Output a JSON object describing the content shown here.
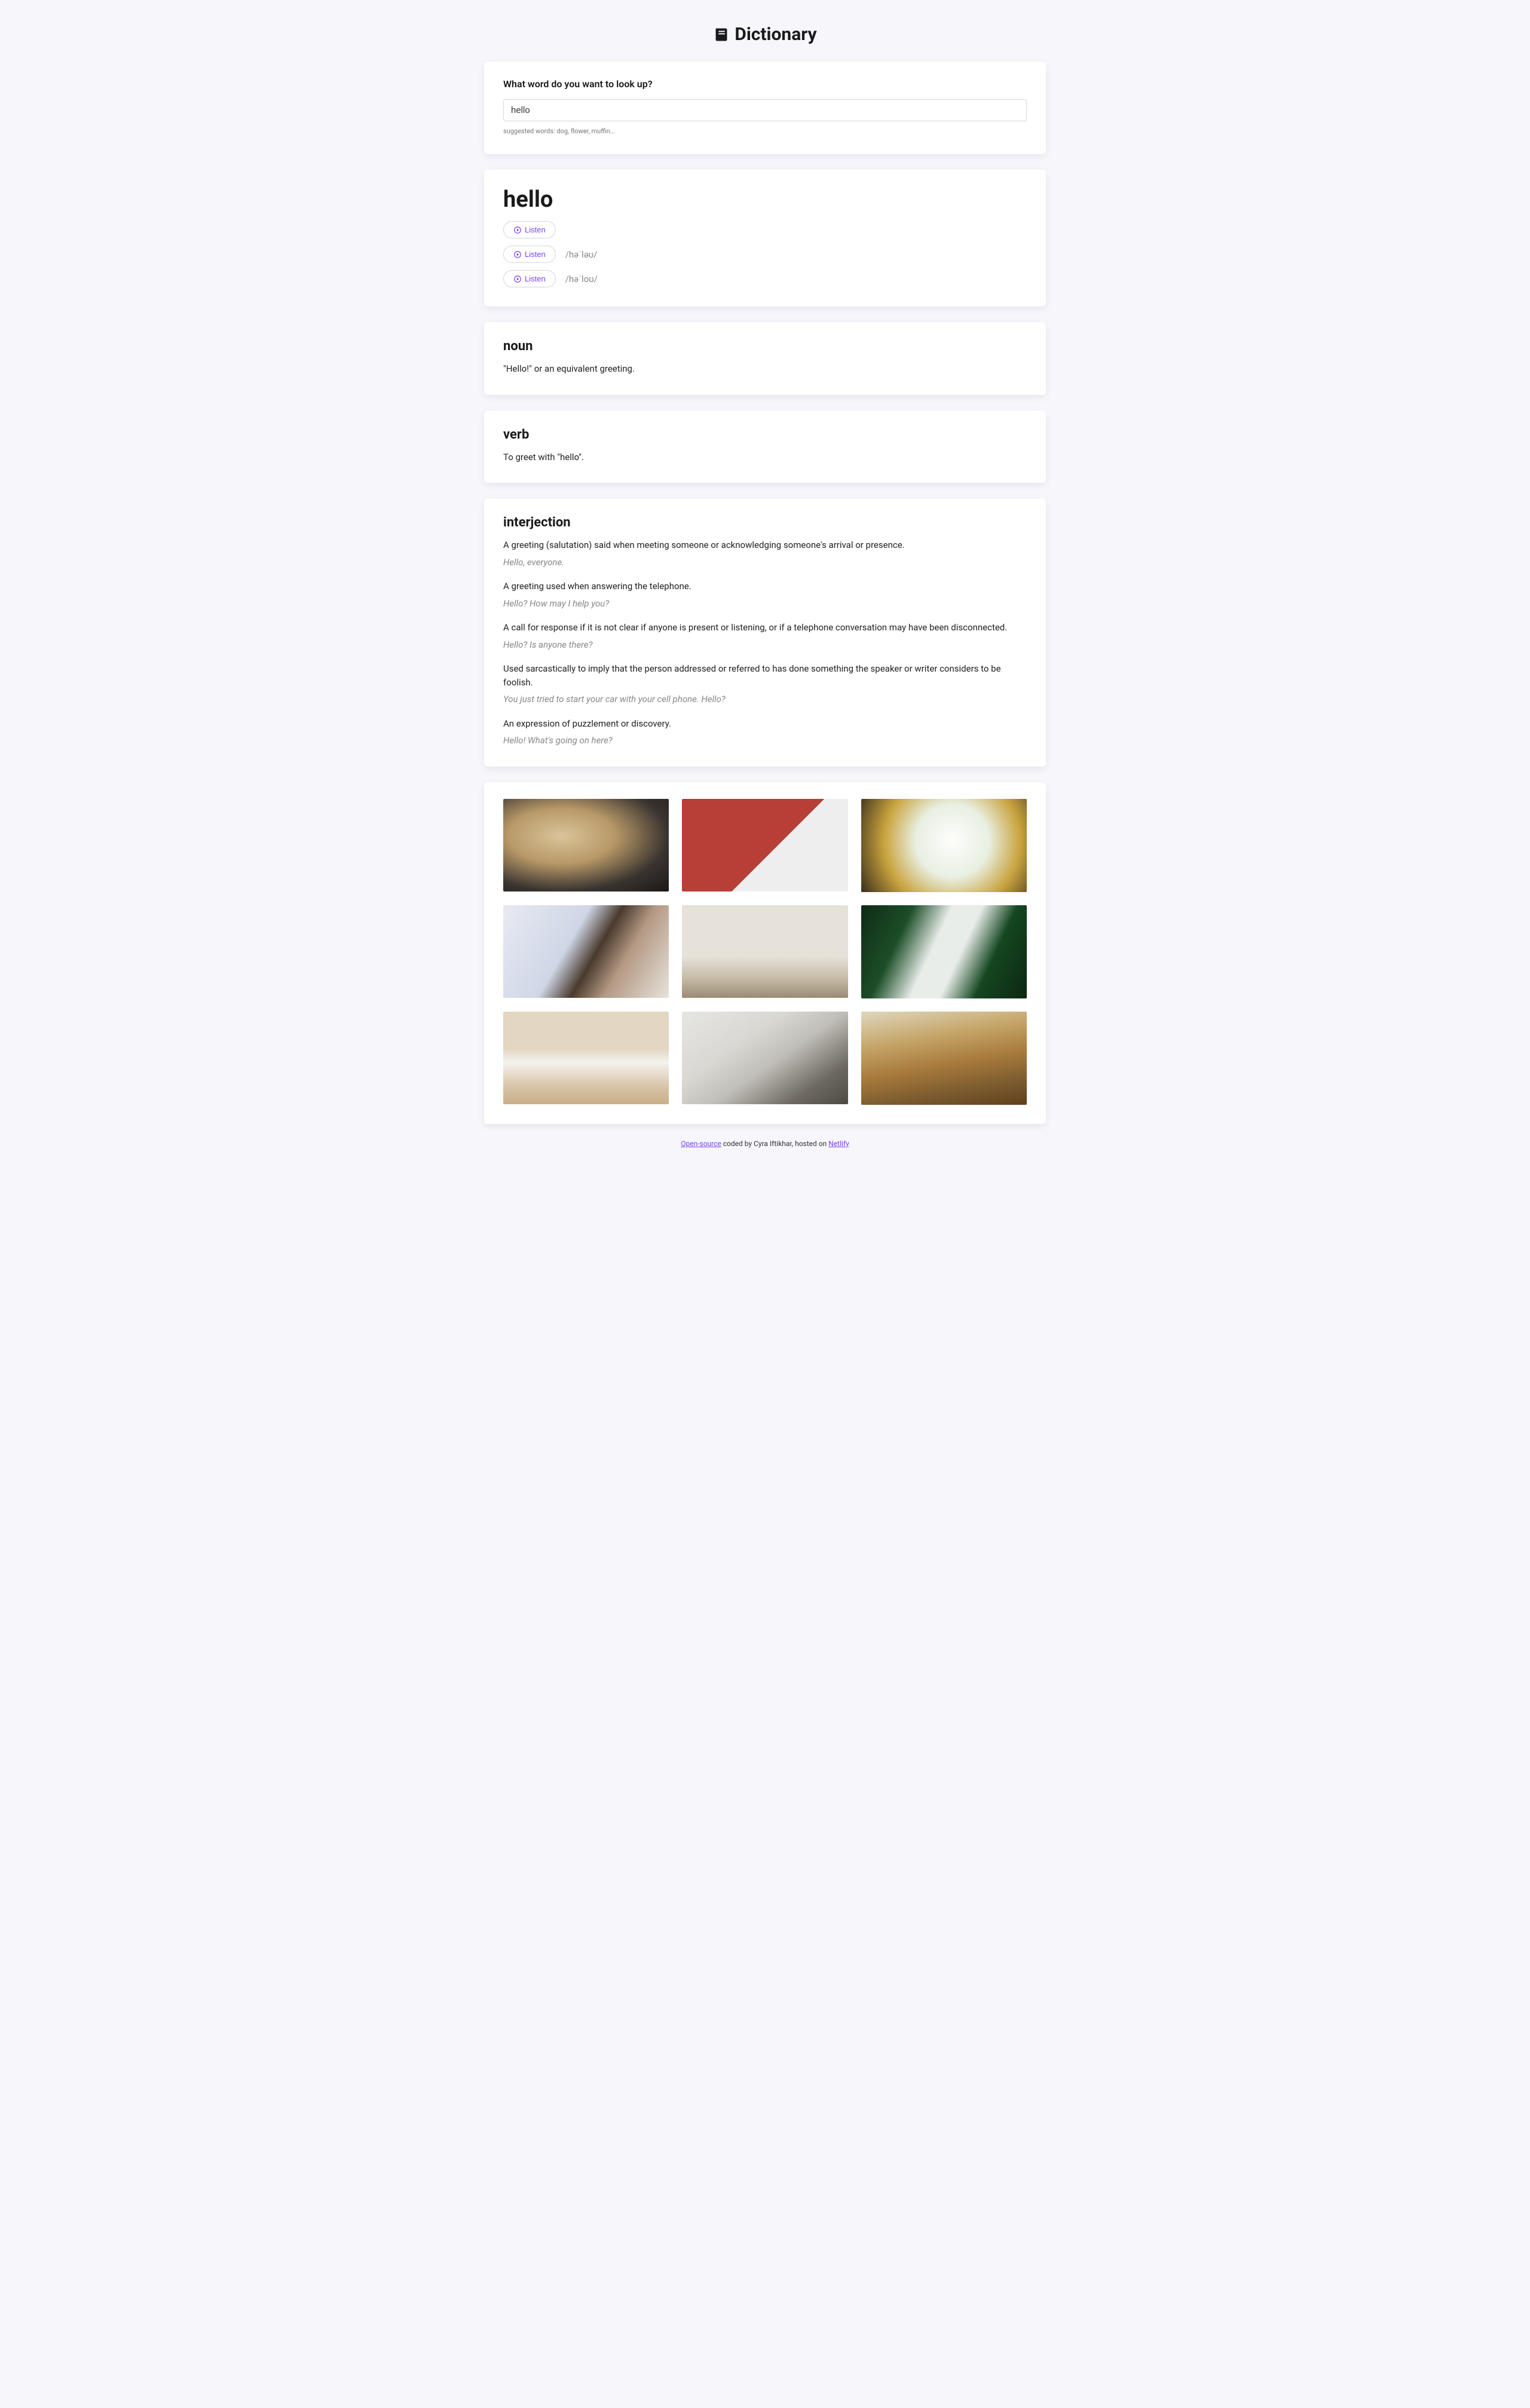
{
  "header": {
    "title": "Dictionary"
  },
  "search": {
    "label": "What word do you want to look up?",
    "value": "hello",
    "hint": "suggested words: dog, flower, muffin..."
  },
  "result": {
    "word": "hello",
    "listen_label": "Listen",
    "phonetics": [
      "",
      "/həˈləʊ/",
      "/həˈloʊ/"
    ]
  },
  "meanings": [
    {
      "pos": "noun",
      "defs": [
        {
          "definition": "\"Hello!\" or an equivalent greeting."
        }
      ]
    },
    {
      "pos": "verb",
      "defs": [
        {
          "definition": "To greet with \"hello\"."
        }
      ]
    },
    {
      "pos": "interjection",
      "defs": [
        {
          "definition": "A greeting (salutation) said when meeting someone or acknowledging someone's arrival or presence.",
          "example": "Hello, everyone."
        },
        {
          "definition": "A greeting used when answering the telephone.",
          "example": "Hello? How may I help you?"
        },
        {
          "definition": "A call for response if it is not clear if anyone is present or listening, or if a telephone conversation may have been disconnected.",
          "example": "Hello? Is anyone there?"
        },
        {
          "definition": "Used sarcastically to imply that the person addressed or referred to has done something the speaker or writer considers to be foolish.",
          "example": "You just tried to start your car with your cell phone. Hello?"
        },
        {
          "definition": "An expression of puzzlement or discovery.",
          "example": "Hello! What's going on here?"
        }
      ]
    }
  ],
  "footer": {
    "open_source": "Open-source",
    "middle": " coded by Cyra Iftikhar, hosted on ",
    "host": "Netlify"
  }
}
